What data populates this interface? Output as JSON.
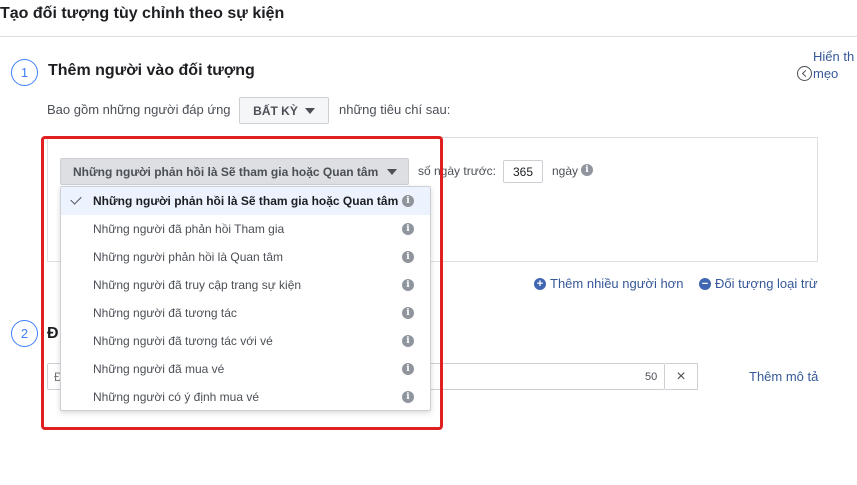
{
  "page": {
    "title": "Tạo đối tượng tùy chỉnh theo sự kiện"
  },
  "tips": {
    "line1": "Hiển th",
    "line2": "mẹo"
  },
  "step1": {
    "number": "1",
    "title": "Thêm người vào đối tượng",
    "include_label": "Bao gồm những người đáp ứng",
    "any_button_label": "BẤT KỲ",
    "criteria_label": "những tiêu chí sau:",
    "event_select_label": "Những người phản hồi là Sẽ tham gia hoặc Quan tâm",
    "days_before_label": "số ngày trước:",
    "days_value": "365",
    "days_label": "ngày",
    "add_more_label": "Thêm nhiều người hơn",
    "exclude_label": "Đối tượng loại trừ"
  },
  "step2": {
    "number": "2",
    "title": "Đ",
    "name_placeholder": "Đ",
    "char_count": "50",
    "clear_icon": "×",
    "add_description_label": "Thêm mô tả"
  },
  "dropdown": {
    "items": [
      {
        "label": "Những người phản hồi là Sẽ tham gia hoặc Quan tâm",
        "selected": true
      },
      {
        "label": "Những người đã phản hồi Tham gia",
        "selected": false
      },
      {
        "label": "Những người phản hồi là Quan tâm",
        "selected": false
      },
      {
        "label": "Những người đã truy cập trang sự kiện",
        "selected": false
      },
      {
        "label": "Những người đã tương tác",
        "selected": false
      },
      {
        "label": "Những người đã tương tác với vé",
        "selected": false
      },
      {
        "label": "Những người đã mua vé",
        "selected": false
      },
      {
        "label": "Những người có ý định mua vé",
        "selected": false
      }
    ]
  },
  "icons": {
    "info": "i",
    "plus": "+",
    "minus": "−"
  },
  "colors": {
    "accent": "#4080ff",
    "link": "#365899",
    "highlight": "#e02020",
    "selected_bg": "#ecf3ff"
  }
}
